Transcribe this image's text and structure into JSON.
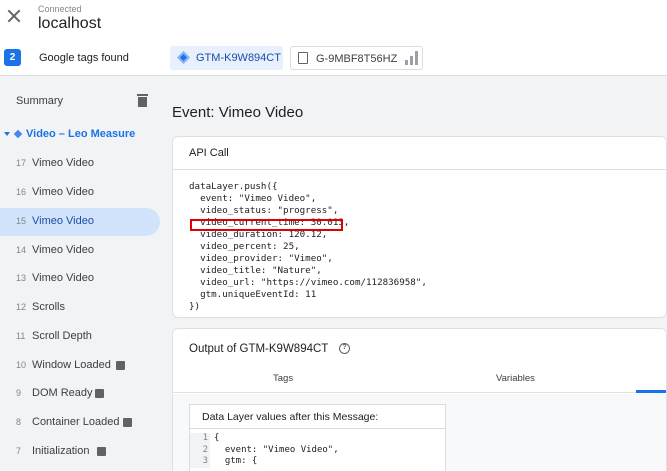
{
  "header": {
    "status": "Connected",
    "host": "localhost"
  },
  "tags_row": {
    "count": "2",
    "label": "Google tags found",
    "gtm_id": "GTM-K9W894CT",
    "ga_id": "G-9MBF8T56HZ"
  },
  "sidebar": {
    "summary": "Summary",
    "container": "Video – Leo Measure",
    "events": [
      {
        "num": "17",
        "label": "Vimeo Video"
      },
      {
        "num": "16",
        "label": "Vimeo Video"
      },
      {
        "num": "15",
        "label": "Vimeo Video"
      },
      {
        "num": "14",
        "label": "Vimeo Video"
      },
      {
        "num": "13",
        "label": "Vimeo Video"
      },
      {
        "num": "12",
        "label": "Scrolls"
      },
      {
        "num": "11",
        "label": "Scroll Depth"
      },
      {
        "num": "10",
        "label": "Window Loaded"
      },
      {
        "num": "9",
        "label": "DOM Ready"
      },
      {
        "num": "8",
        "label": "Container Loaded"
      },
      {
        "num": "7",
        "label": "Initialization"
      }
    ]
  },
  "main": {
    "title": "Event: Vimeo Video",
    "api_card": {
      "title": "API Call",
      "lines": [
        "dataLayer.push({",
        "  event: \"Vimeo Video\",",
        "  video_status: \"progress\",",
        "  video_current_time: 30.013,",
        "  video_duration: 120.12,",
        "  video_percent: 25,",
        "  video_provider: \"Vimeo\",",
        "  video_title: \"Nature\",",
        "  video_url: \"https://vimeo.com/112836958\",",
        "  gtm.uniqueEventId: 11",
        "})"
      ]
    },
    "output_card": {
      "title": "Output of GTM-K9W894CT",
      "help": "?",
      "tabs": [
        "Tags",
        "Variables"
      ],
      "dl_title": "Data Layer values after this Message:",
      "dl_line_numbers": [
        "1",
        "2",
        "3"
      ],
      "dl_lines": [
        "{",
        "  event: \"Vimeo Video\",",
        "  gtm: {"
      ]
    }
  }
}
